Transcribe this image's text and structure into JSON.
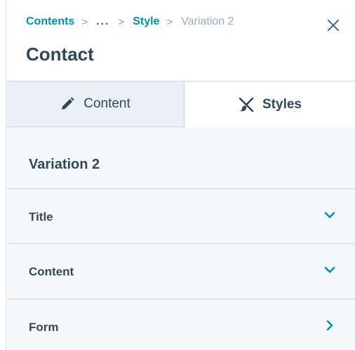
{
  "breadcrumb": {
    "items": [
      "Contents",
      "...",
      "Style",
      "Variation 2"
    ],
    "separator": ">"
  },
  "panel": {
    "title": "Contact"
  },
  "tabs": [
    {
      "label": "Content",
      "icon": "pencil-icon",
      "selected": false
    },
    {
      "label": "Styles",
      "icon": "styles-icon",
      "selected": true
    }
  ],
  "section": {
    "title": "Variation 2"
  },
  "accordions": [
    {
      "label": "Title",
      "icon": "chevron-down-icon"
    },
    {
      "label": "Content",
      "icon": "chevron-down-icon"
    },
    {
      "label": "Form",
      "icon": "chevron-right-icon"
    }
  ],
  "colors": {
    "link": "#0091ae",
    "text": "#33475b",
    "muted": "#99acc2",
    "tab_bg": "#eaf0f6",
    "body_bg": "#f5f8fa",
    "border": "#cbd6e2"
  }
}
